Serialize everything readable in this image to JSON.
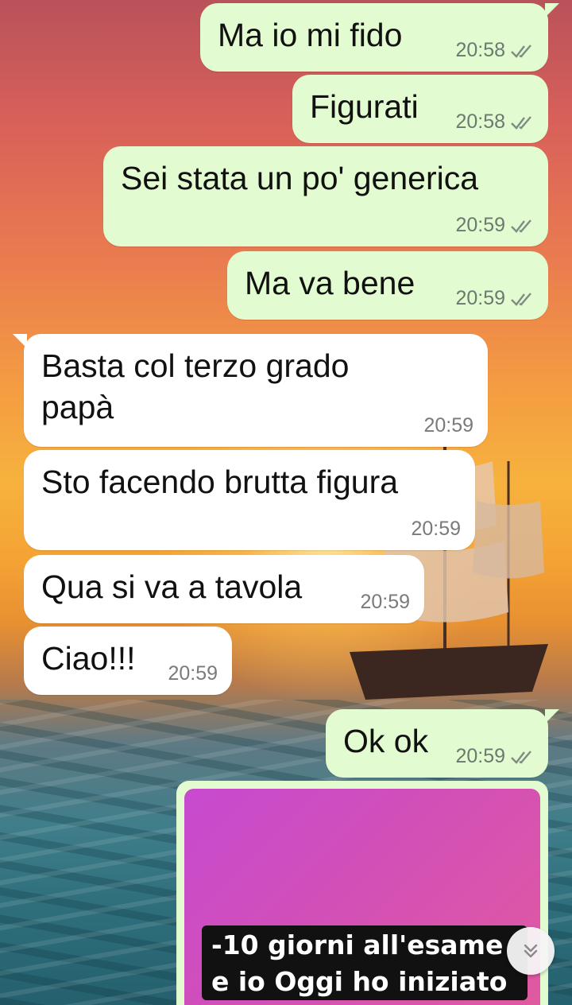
{
  "chat": {
    "messages": [
      {
        "direction": "outgoing",
        "text": "Ma io mi fido",
        "time": "20:58",
        "status": "read"
      },
      {
        "direction": "outgoing",
        "text": "Figurati",
        "time": "20:58",
        "status": "read"
      },
      {
        "direction": "outgoing",
        "text": "Sei stata un po' generica",
        "time": "20:59",
        "status": "read"
      },
      {
        "direction": "outgoing",
        "text": "Ma va bene",
        "time": "20:59",
        "status": "read"
      },
      {
        "direction": "incoming",
        "text": "Basta col terzo grado\npapà",
        "time": "20:59"
      },
      {
        "direction": "incoming",
        "text": "Sto facendo brutta figura",
        "time": "20:59"
      },
      {
        "direction": "incoming",
        "text": "Qua si va a tavola",
        "time": "20:59"
      },
      {
        "direction": "incoming",
        "text": "Ciao!!!",
        "time": "20:59"
      },
      {
        "direction": "outgoing",
        "text": "Ok ok",
        "time": "20:59",
        "status": "read"
      }
    ],
    "media": {
      "caption": "-10 giorni all'esame\ne io Oggi ho iniziato"
    }
  },
  "icons": {
    "read_receipt": "double-check-icon",
    "scroll_down": "double-chevron-down-icon"
  },
  "colors": {
    "outgoing_bubble": "#e3fbd0",
    "incoming_bubble": "#ffffff",
    "media_gradient_start": "#c74ad0",
    "media_gradient_end": "#e05aa0"
  }
}
